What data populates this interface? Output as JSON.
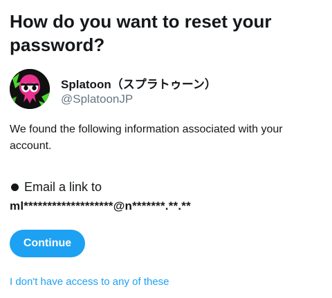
{
  "header": {
    "title": "How do you want to reset your password?"
  },
  "profile": {
    "name": "Splatoon（スプラトゥーン）",
    "handle": "@SplatoonJP",
    "avatar_icon": "squid-icon",
    "avatar_colors": {
      "background": "#101010",
      "squid": "#e8308c",
      "splat": "#4cd62a"
    }
  },
  "message": {
    "text": "We found the following information associated with your account."
  },
  "option": {
    "label": "Email a link to",
    "value": "ml*******************@n*******.**.**",
    "selected": true
  },
  "actions": {
    "continue_label": "Continue",
    "no_access_label": "I don't have access to any of these"
  },
  "colors": {
    "accent": "#1da1f2",
    "text": "#14171a",
    "secondary": "#657786"
  }
}
